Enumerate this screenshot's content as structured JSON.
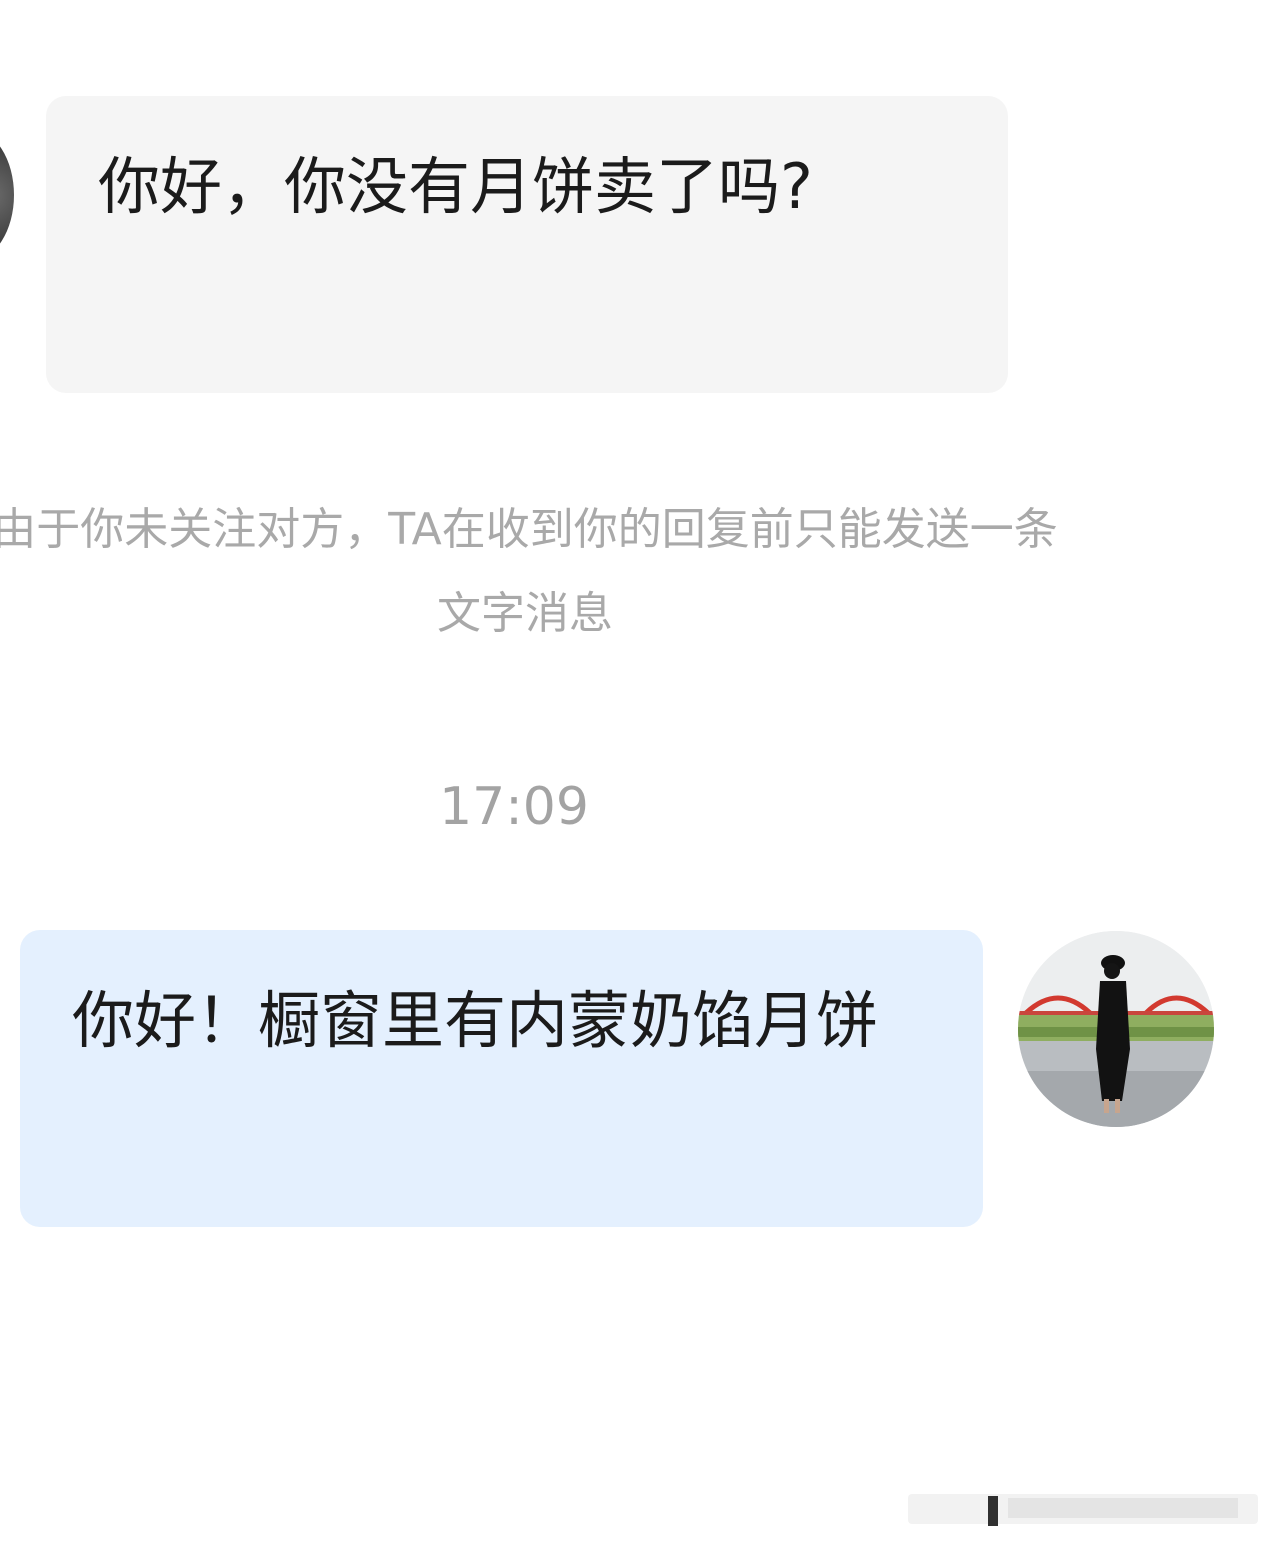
{
  "messages": [
    {
      "direction": "incoming",
      "text": "你好，你没有月饼卖了吗?"
    },
    {
      "direction": "outgoing",
      "text": "你好！橱窗里有内蒙奶馅月饼"
    }
  ],
  "system_notice": {
    "text": "由于你未关注对方，TA在收到你的回复前只能发送一条文字消息"
  },
  "timestamp": "17:09",
  "avatars": {
    "incoming": "user-avatar-dark",
    "outgoing": "user-avatar-photo-woman-by-river"
  }
}
